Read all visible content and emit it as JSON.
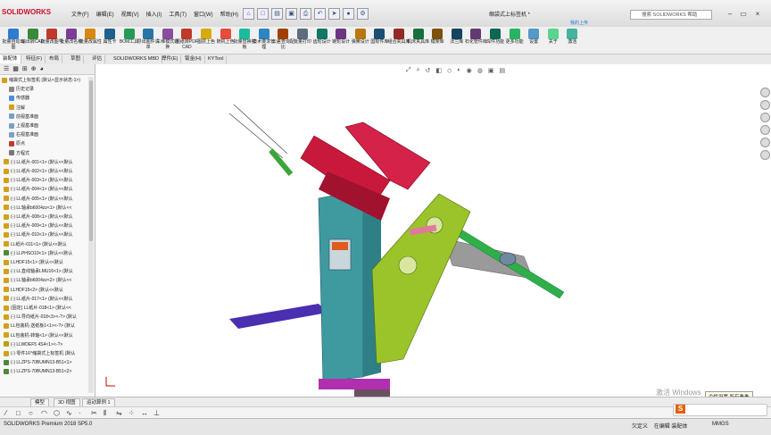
{
  "app": {
    "logo": "SOLIDWORKS",
    "doc_title": "缩袋式上标签机 *",
    "search_placeholder": "搜索 SOLIDWORKS 帮助",
    "cloud_label": "我的上传"
  },
  "menu": [
    "文件(F)",
    "编辑(E)",
    "视图(V)",
    "插入(I)",
    "工具(T)",
    "窗口(W)",
    "帮助(H)"
  ],
  "ribbon": [
    {
      "label": "批量自动出图",
      "color": "#2e7bd4"
    },
    {
      "label": "输出转CAD",
      "color": "#3a8a3a"
    },
    {
      "label": "批量改图号",
      "color": "#c0392b"
    },
    {
      "label": "批量改名称",
      "color": "#7d3c98"
    },
    {
      "label": "批量改属性",
      "color": "#d68910"
    },
    {
      "label": "属性卡",
      "color": "#1f618d"
    },
    {
      "label": "BOM工具",
      "color": "#239b56"
    },
    {
      "label": "导出图件清单",
      "color": "#2874a6"
    },
    {
      "label": "三维模式转换",
      "color": "#884ea0"
    },
    {
      "label": "图纸转PDFCAD",
      "color": "#c0392b"
    },
    {
      "label": "图层上色",
      "color": "#d4ac0d"
    },
    {
      "label": "随机上色",
      "color": "#e74c3c"
    },
    {
      "label": "批量替换模板",
      "color": "#1abc9c"
    },
    {
      "label": "技术要求管理",
      "color": "#2e86c1"
    },
    {
      "label": "公差查询配比",
      "color": "#a04000"
    },
    {
      "label": "批量打印",
      "color": "#5d6d7e"
    },
    {
      "label": "齿轮设计",
      "color": "#117864"
    },
    {
      "label": "链轮设计",
      "color": "#6c3483"
    },
    {
      "label": "弹簧设计",
      "color": "#b9770e"
    },
    {
      "label": "国标件库",
      "color": "#1b4f72"
    },
    {
      "label": "组合夹具库",
      "color": "#922b21"
    },
    {
      "label": "机床夹具库",
      "color": "#196f3d"
    },
    {
      "label": "模架库",
      "color": "#7e5109"
    },
    {
      "label": "法兰库",
      "color": "#154360"
    },
    {
      "label": "石化管件库",
      "color": "#633974"
    },
    {
      "label": "焊件功能",
      "color": "#0e6655"
    },
    {
      "label": "更多功能",
      "color": "#28b463"
    },
    {
      "label": "设置",
      "color": "#5499c7"
    },
    {
      "label": "关于",
      "color": "#58d68d"
    },
    {
      "label": "激活",
      "color": "#45b39d"
    }
  ],
  "tabs": [
    "装配体",
    "特征(F)",
    "布局",
    "草图",
    "评估",
    "SOLIDWORKS MBD",
    "焊件(E)",
    "钣金(H)",
    "KYTool"
  ],
  "tree": [
    {
      "label": "缩袋式上标签机 (默认<显示状态-1>)",
      "color": "#d4a017"
    },
    {
      "label": "历史记录",
      "color": "#888"
    },
    {
      "label": "传感器",
      "color": "#4a90d9"
    },
    {
      "label": "注解",
      "color": "#d4a017"
    },
    {
      "label": "前视基准面",
      "color": "#7aa0c4"
    },
    {
      "label": "上视基准面",
      "color": "#7aa0c4"
    },
    {
      "label": "右视基准面",
      "color": "#7aa0c4"
    },
    {
      "label": "原点",
      "color": "#c0392b"
    },
    {
      "label": "方程式",
      "color": "#777"
    },
    {
      "label": "(-) LL纸片-001<1> (默认<<默认",
      "color": "#d4a017"
    },
    {
      "label": "(-) LL纸片-002<1> (默认<<默认",
      "color": "#d4a017"
    },
    {
      "label": "(-) LL纸片-003<1> (默认<<默认",
      "color": "#d4a017"
    },
    {
      "label": "(-) LL纸片-004<1> (默认<<默认",
      "color": "#d4a017"
    },
    {
      "label": "(-) LL纸片-005<1> (默认<<默认",
      "color": "#d4a017"
    },
    {
      "label": "(-) LL轴承b6004zz<1> (默认<<",
      "color": "#d4a017"
    },
    {
      "label": "(-) LL纸片-008<1> (默认<<默认",
      "color": "#d4a017"
    },
    {
      "label": "(-) LL纸片-009<1> (默认<<默认",
      "color": "#d4a017"
    },
    {
      "label": "(-) LL纸片-010<1> (默认<<默认",
      "color": "#d4a017"
    },
    {
      "label": "LL纸片-011<1> (默认<<默认",
      "color": "#d4a017"
    },
    {
      "label": "(-) LLPHSO10<1> (默认<<默认",
      "color": "#4a8a3a"
    },
    {
      "label": "LLHDF15<1> (默认<<默认",
      "color": "#d4a017"
    },
    {
      "label": "(-) LL直线轴承LMU16<1> (默认",
      "color": "#d4a017"
    },
    {
      "label": "(-) LL轴承b6004zz<2> (默认<<",
      "color": "#d4a017"
    },
    {
      "label": "LLHDF15<2> (默认<<默认",
      "color": "#d4a017"
    },
    {
      "label": "(-) LL纸片-017<1> (默认<<默认",
      "color": "#d4a017"
    },
    {
      "label": "(固定) LL纸片-018<1> (默认<<",
      "color": "#d4a017"
    },
    {
      "label": "(-) LL导向纸片-018<3><-?> (默认",
      "color": "#d4a017"
    },
    {
      "label": "LL包装机-送纸板1<1><-?> (默认",
      "color": "#d4a017"
    },
    {
      "label": "LL包装机-转轴<1> (默认<<默认",
      "color": "#d4a017"
    },
    {
      "label": "(-) LLWDEF5 4S4<1><-?>",
      "color": "#c0a000"
    },
    {
      "label": "(-) 零件16^缩袋式上标签机 (默认",
      "color": "#d4a017"
    },
    {
      "label": "(-) LLZPS-70BUMN13-B51<1>",
      "color": "#4a8a3a"
    },
    {
      "label": "(-) LLZPS-70BUMN13-B51<2>",
      "color": "#4a8a3a"
    }
  ],
  "bottom_tabs": [
    "模型",
    "3D 视图",
    "运动算例 1"
  ],
  "status": {
    "left": "SOLIDWORKS Premium 2018 SP5.0",
    "mid": "欠定义",
    "mode": "在编辑 装配体",
    "units": "MMGS"
  },
  "watermark": "激活 Windows",
  "tooltip": "个性设置 所有看看",
  "ime": "S"
}
